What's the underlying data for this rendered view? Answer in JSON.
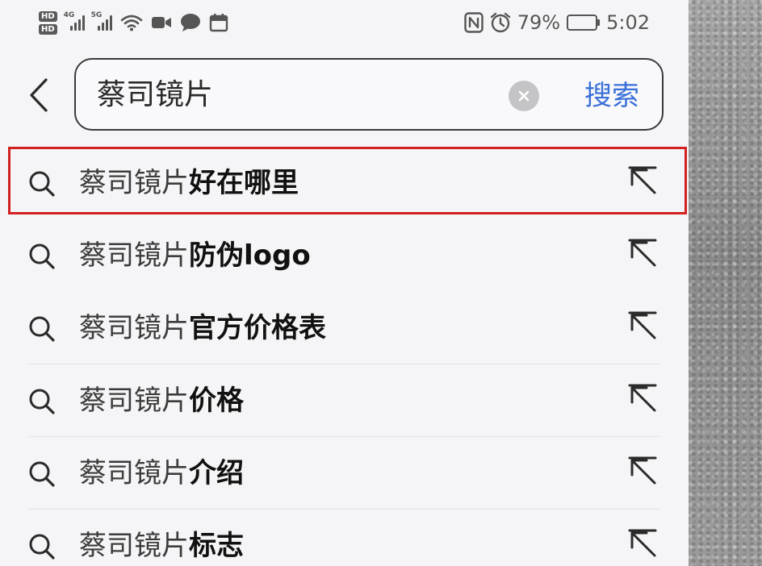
{
  "status_bar": {
    "hd1": "HD",
    "hd2": "HD",
    "sig1_gen": "4G",
    "sig2_gen": "5G",
    "battery_percent": "79%",
    "battery_level": 0.79,
    "time": "5:02",
    "icons": [
      "hd-icon",
      "signal-4g-icon",
      "signal-5g-icon",
      "wifi-icon",
      "video-icon",
      "message-icon",
      "calendar-icon",
      "nfc-icon",
      "alarm-icon",
      "battery-icon"
    ]
  },
  "search": {
    "query": "蔡司镜片",
    "submit_label": "搜索",
    "icons": [
      "back-chevron-icon",
      "clear-icon"
    ]
  },
  "suggestions": [
    {
      "base": "蔡司镜片",
      "suffix": "好在哪里"
    },
    {
      "base": "蔡司镜片",
      "suffix": "防伪logo"
    },
    {
      "base": "蔡司镜片",
      "suffix": "官方价格表"
    },
    {
      "base": "蔡司镜片",
      "suffix": "价格"
    },
    {
      "base": "蔡司镜片",
      "suffix": "介绍"
    },
    {
      "base": "蔡司镜片",
      "suffix": "标志"
    }
  ],
  "colors": {
    "accent": "#3a6fd8",
    "highlight": "#d32020",
    "text": "#333333"
  }
}
